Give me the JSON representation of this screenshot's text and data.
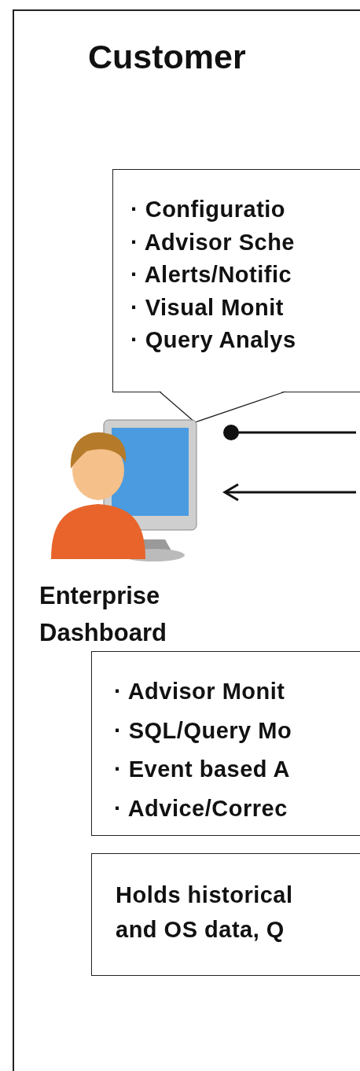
{
  "title": "Customer",
  "callout": {
    "bullet": "·",
    "items": [
      "Configuratio",
      "Advisor Sche",
      "Alerts/Notific",
      "Visual Monit",
      "Query Analys"
    ]
  },
  "node": {
    "label_lines": [
      "Enterprise",
      "Dashboard"
    ]
  },
  "connectors": [
    {
      "kind": "dot"
    },
    {
      "kind": "arrow"
    }
  ],
  "features": {
    "bullet": "·",
    "items": [
      "Advisor Monit",
      "SQL/Query Mo",
      "Event based A",
      "Advice/Correc"
    ]
  },
  "storage": {
    "lines": [
      "Holds historical",
      "and OS data, Q"
    ]
  }
}
